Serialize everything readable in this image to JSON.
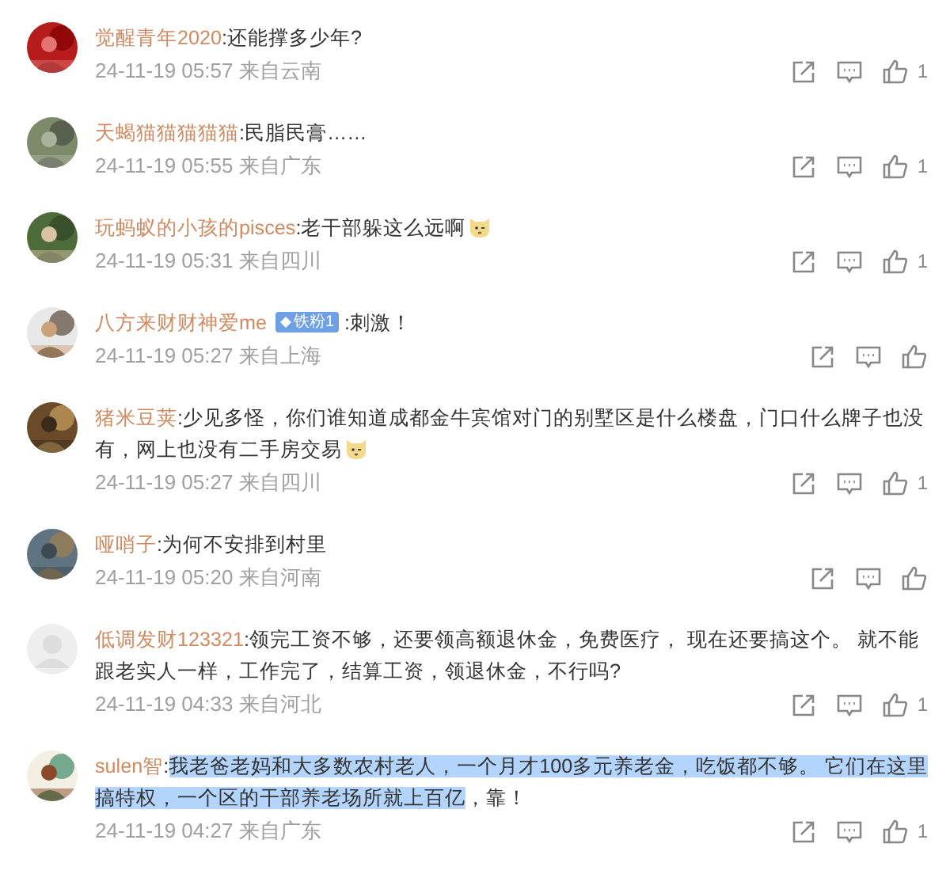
{
  "comments": [
    {
      "user": "觉醒青年2020",
      "text_parts": [
        {
          "text": ":还能撑多少年?",
          "selected": false
        }
      ],
      "trailing_emoji": false,
      "meta": "24-11-19 05:57 来自云南",
      "likes": "1"
    },
    {
      "user": "天蝎猫猫猫猫猫",
      "text_parts": [
        {
          "text": ":民脂民膏……",
          "selected": false
        }
      ],
      "trailing_emoji": false,
      "meta": "24-11-19 05:55 来自广东",
      "likes": "1"
    },
    {
      "user": "玩蚂蚁的小孩的pisces",
      "text_parts": [
        {
          "text": ":老干部躲这么远啊",
          "selected": false
        }
      ],
      "trailing_emoji": true,
      "meta": "24-11-19 05:31 来自四川",
      "likes": "1"
    },
    {
      "user": "八方来财财神爱me",
      "badge": "铁粉1",
      "text_parts": [
        {
          "text": " :刺激！",
          "selected": false
        }
      ],
      "trailing_emoji": false,
      "meta": "24-11-19 05:27 来自上海"
    },
    {
      "user": "猪米豆荚",
      "text_parts": [
        {
          "text": ":少见多怪，你们谁知道成都金牛宾馆对门的别墅区是什么楼盘，门口什么牌子也没有，网上也没有二手房交易",
          "selected": false
        }
      ],
      "trailing_emoji": true,
      "meta": "24-11-19 05:27 来自四川",
      "likes": "1"
    },
    {
      "user": "哑哨子",
      "text_parts": [
        {
          "text": ":为何不安排到村里",
          "selected": false
        }
      ],
      "trailing_emoji": false,
      "meta": "24-11-19 05:20 来自河南"
    },
    {
      "user": "低调发财123321",
      "avatar": {
        "kind": "default"
      },
      "text_parts": [
        {
          "text": ":领完工资不够，还要领高额退休金，免费医疗， 现在还要搞这个。 就不能跟老实人一样，工作完了，结算工资，领退休金，不行吗?",
          "selected": false
        }
      ],
      "trailing_emoji": false,
      "meta": "24-11-19 04:33 来自河北",
      "likes": "1"
    },
    {
      "user": "sulen智",
      "text_parts": [
        {
          "text": ":",
          "selected": false
        },
        {
          "text": "我老爸老妈和大多数农村老人，一个月才100多元养老金，吃饭都不够。 它们在这里搞特权，一个区的干部养老场所就上百亿",
          "selected": true
        },
        {
          "text": "，靠！",
          "selected": false
        }
      ],
      "trailing_emoji": false,
      "meta": "24-11-19 04:27 来自广东",
      "likes": "1"
    }
  ]
}
